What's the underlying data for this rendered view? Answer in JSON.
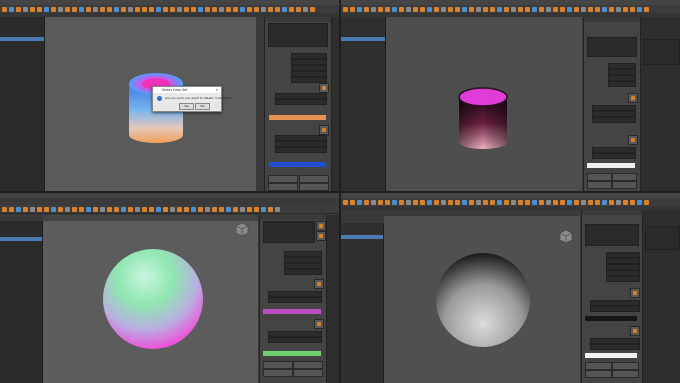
{
  "accent": "#d9822b",
  "selection": "#4a7ab0",
  "quadrants": {
    "top_left": {
      "dialog": {
        "title": "Select Color Set",
        "message": "Are you sure you want to delete \"colorSet2\"?",
        "yes": "Yes",
        "no": "No",
        "close": "×",
        "icon": "question-icon"
      },
      "swatches": [
        "#e6934f",
        "#1f4fcf"
      ],
      "object": "cylinder"
    },
    "top_right": {
      "swatches": [
        "#f0f0f0"
      ],
      "object": "cylinder"
    },
    "bottom_left": {
      "swatches": [
        "#c04cc4",
        "#6fcf6f"
      ],
      "object": "sphere"
    },
    "bottom_right": {
      "swatches": [
        "#f2f2f2"
      ],
      "object": "sphere"
    }
  }
}
